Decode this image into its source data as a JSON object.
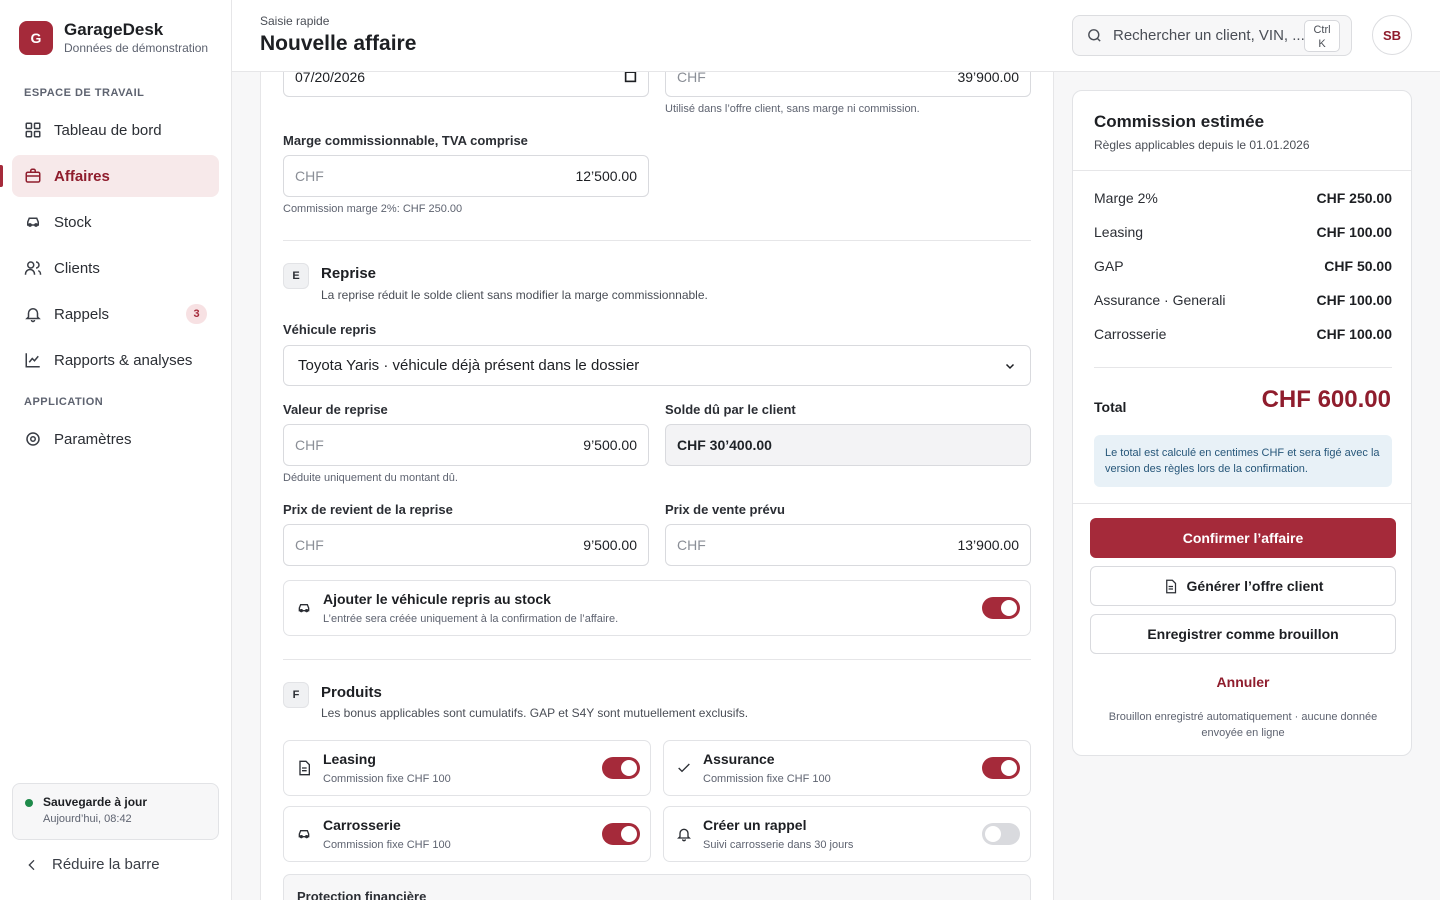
{
  "app": {
    "logo_letter": "G",
    "name": "GarageDesk",
    "subtitle": "Données de démonstration"
  },
  "sidebar": {
    "section_workspace": "Espace de travail",
    "section_app": "Application",
    "items": [
      {
        "label": "Tableau de bord",
        "icon": "dashboard-icon"
      },
      {
        "label": "Affaires",
        "icon": "briefcase-icon",
        "active": true
      },
      {
        "label": "Stock",
        "icon": "car-icon"
      },
      {
        "label": "Clients",
        "icon": "users-icon"
      },
      {
        "label": "Rappels",
        "icon": "bell-icon",
        "badge": "3"
      },
      {
        "label": "Rapports & analyses",
        "icon": "chart-icon"
      },
      {
        "label": "Paramètres",
        "icon": "gear-icon"
      }
    ],
    "save_status": {
      "title": "Sauvegarde à jour",
      "time": "Aujourd’hui, 08:42"
    },
    "collapse_label": "Réduire la barre"
  },
  "header": {
    "breadcrumb": "Saisie rapide",
    "title": "Nouvelle affaire",
    "search": {
      "placeholder": "Rechercher un client, VIN, ...",
      "shortcut_1": "Ctrl",
      "shortcut_2": "K"
    },
    "user_initials": "SB"
  },
  "form": {
    "date_value": "07/20/2026",
    "price_currency": "CHF",
    "price_value": "39’900.00",
    "price_hint": "Utilisé dans l’offre client, sans marge ni commission.",
    "margin_label": "Marge commissionnable, TVA comprise",
    "margin_currency": "CHF",
    "margin_value": "12’500.00",
    "margin_hint": "Commission marge 2%: CHF 250.00",
    "reprise": {
      "letter": "E",
      "title": "Reprise",
      "desc": "La reprise réduit le solde client sans modifier la marge commissionnable.",
      "vehicle_label": "Véhicule repris",
      "vehicle_value": "Toyota Yaris · véhicule déjà présent dans le dossier",
      "value_label": "Valeur de reprise",
      "value_currency": "CHF",
      "value_amount": "9’500.00",
      "value_hint": "Déduite uniquement du montant dû.",
      "due_label": "Solde dû par le client",
      "due_amount": "CHF 30’400.00",
      "cost_label": "Prix de revient de la reprise",
      "cost_currency": "CHF",
      "cost_amount": "9’500.00",
      "sale_label": "Prix de vente prévu",
      "sale_currency": "CHF",
      "sale_amount": "13’900.00",
      "stock_title": "Ajouter le véhicule repris au stock",
      "stock_sub": "L’entrée sera créée uniquement à la confirmation de l’affaire.",
      "stock_on": true
    },
    "produits": {
      "letter": "F",
      "title": "Produits",
      "desc": "Les bonus applicables sont cumulatifs. GAP et S4Y sont mutuellement exclusifs.",
      "items": [
        {
          "title": "Leasing",
          "sub": "Commission fixe CHF 100",
          "on": true
        },
        {
          "title": "Assurance",
          "sub": "Commission fixe CHF 100",
          "on": true
        },
        {
          "title": "Carrosserie",
          "sub": "Commission fixe CHF 100",
          "on": true
        },
        {
          "title": "Créer un rappel",
          "sub": "Suivi carrosserie dans 30 jours",
          "on": false
        }
      ],
      "protection_title": "Protection financière"
    }
  },
  "commission": {
    "title": "Commission estimée",
    "subtitle": "Règles applicables depuis le 01.01.2026",
    "rows": [
      {
        "label": "Marge 2%",
        "value": "CHF 250.00"
      },
      {
        "label": "Leasing",
        "value": "CHF 100.00"
      },
      {
        "label": "GAP",
        "value": "CHF 50.00"
      },
      {
        "label": "Assurance · Generali",
        "value": "CHF 100.00"
      },
      {
        "label": "Carrosserie",
        "value": "CHF 100.00"
      }
    ],
    "total_label": "Total",
    "total_value": "CHF 600.00",
    "info": "Le total est calculé en centimes CHF et sera figé avec la version des règles lors de la confirmation.",
    "confirm": "Confirmer l’affaire",
    "generate": "Générer l’offre client",
    "draft": "Enregistrer comme brouillon",
    "cancel": "Annuler",
    "footer": "Brouillon enregistré automatiquement · aucune donnée envoyée en ligne"
  },
  "colors": {
    "accent": "#a52a3a",
    "accent_dark": "#8f1d2d",
    "status_ok": "#1e8a4a"
  }
}
